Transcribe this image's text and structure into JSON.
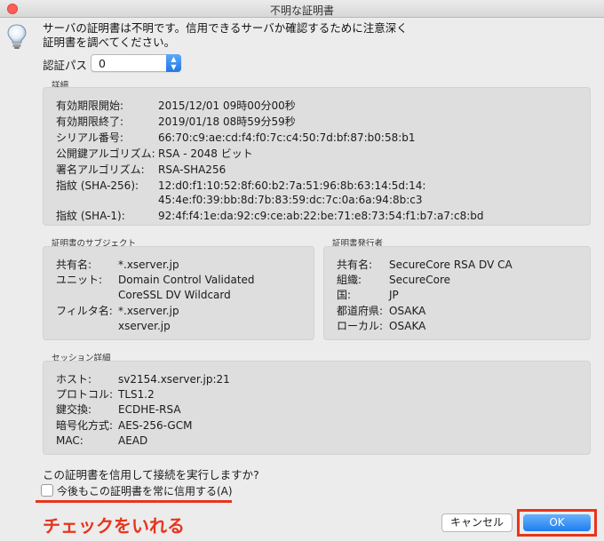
{
  "window": {
    "title": "不明な証明書"
  },
  "message": {
    "line1": "サーバの証明書は不明です。信用できるサーバか確認するために注意深く",
    "line2": "証明書を調べてください。"
  },
  "cert_path": {
    "label": "認証パス",
    "value": "0"
  },
  "details": {
    "label": "詳細",
    "rows": [
      {
        "key": "有効期限開始:",
        "value": "2015/12/01 09時00分00秒"
      },
      {
        "key": "有効期限終了:",
        "value": "2019/01/18 08時59分59秒"
      },
      {
        "key": "シリアル番号:",
        "value": "66:70:c9:ae:cd:f4:f0:7c:c4:50:7d:bf:87:b0:58:b1"
      },
      {
        "key": "公開鍵アルゴリズム:",
        "value": "RSA - 2048 ビット"
      },
      {
        "key": "署名アルゴリズム:",
        "value": "RSA-SHA256"
      },
      {
        "key": "指紋 (SHA-256):",
        "value": "12:d0:f1:10:52:8f:60:b2:7a:51:96:8b:63:14:5d:14:"
      },
      {
        "key": "",
        "value": "45:4e:f0:39:bb:8d:7b:83:59:dc:7c:0a:6a:94:8b:c3"
      },
      {
        "key": "指紋 (SHA-1):",
        "value": "92:4f:f4:1e:da:92:c9:ce:ab:22:be:71:e8:73:54:f1:b7:a7:c8:bd"
      }
    ]
  },
  "subject": {
    "label": "証明書のサブジェクト",
    "rows": [
      {
        "key": "共有名:",
        "value": "*.xserver.jp"
      },
      {
        "key": "ユニット:",
        "value": "Domain Control Validated"
      },
      {
        "key": "",
        "value": "CoreSSL DV Wildcard"
      },
      {
        "key": "フィルタ名:",
        "value": "*.xserver.jp"
      },
      {
        "key": "",
        "value": "xserver.jp"
      }
    ]
  },
  "issuer": {
    "label": "証明書発行者",
    "rows": [
      {
        "key": "共有名:",
        "value": "SecureCore RSA DV CA"
      },
      {
        "key": "組織:",
        "value": "SecureCore"
      },
      {
        "key": "国:",
        "value": "JP"
      },
      {
        "key": "都道府県:",
        "value": "OSAKA"
      },
      {
        "key": "ローカル:",
        "value": "OSAKA"
      }
    ]
  },
  "session": {
    "label": "セッション詳細",
    "rows": [
      {
        "key": "ホスト:",
        "value": "sv2154.xserver.jp:21"
      },
      {
        "key": "プロトコル:",
        "value": "TLS1.2"
      },
      {
        "key": "鍵交換:",
        "value": "ECDHE-RSA"
      },
      {
        "key": "暗号化方式:",
        "value": "AES-256-GCM"
      },
      {
        "key": "MAC:",
        "value": "AEAD"
      }
    ]
  },
  "question": "この証明書を信用して接続を実行しますか?",
  "always_trust_label": "今後もこの証明書を常に信用する(A)",
  "annotation": "チェックをいれる",
  "buttons": {
    "cancel": "キャンセル",
    "ok": "OK"
  },
  "colors": {
    "annotation_red": "#e8341c",
    "ok_blue": "#1f7ef0",
    "close_red": "#fd5f57"
  }
}
